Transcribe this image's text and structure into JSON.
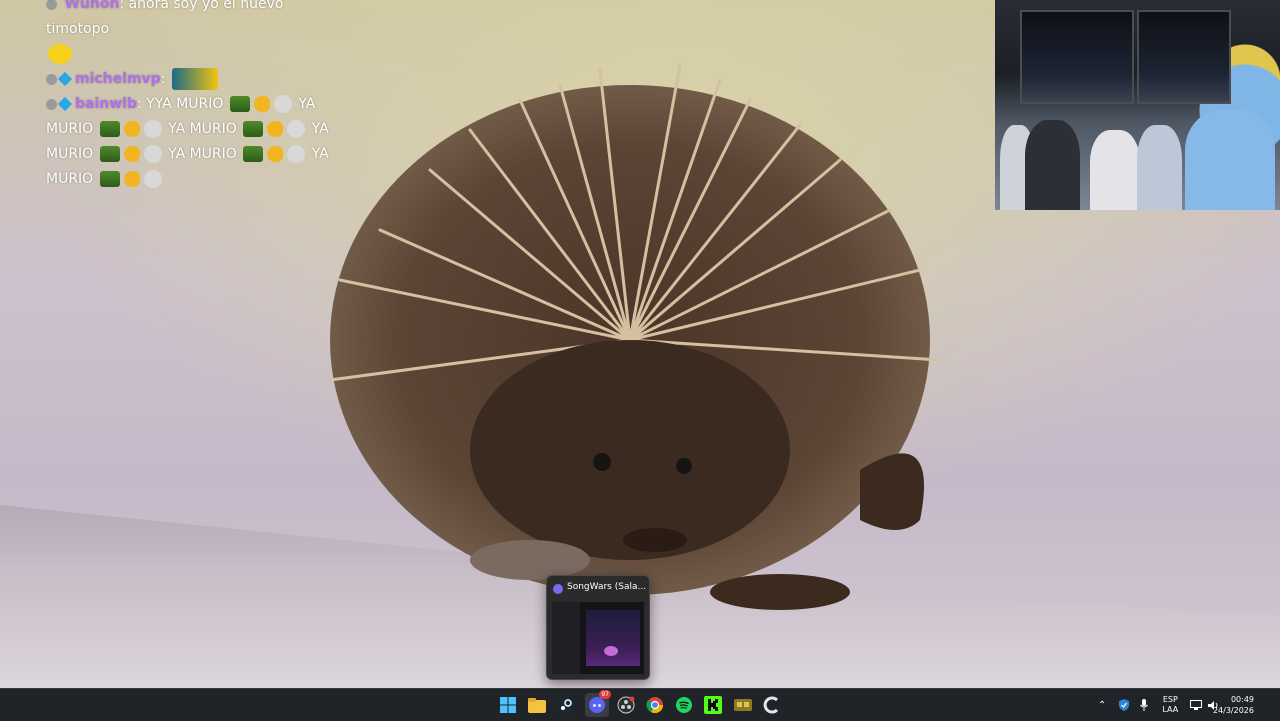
{
  "chat": {
    "messages": [
      {
        "user": "Wuhoh",
        "text": ": ahora soy yo el nuevo timotopo"
      },
      {
        "user": "",
        "text": ""
      },
      {
        "user": "michelmvp",
        "text": ":"
      },
      {
        "user": "bainwlb",
        "text": ": YYA MURIO"
      }
    ],
    "spam_words": [
      "YA",
      "MURIO",
      "YA MURIO",
      "YA",
      "MURIO",
      "YA MURIO",
      "YA",
      "MURIO"
    ]
  },
  "preview": {
    "title": "SongWars (Sala..."
  },
  "taskbar": {
    "icons": [
      "windows-start-icon",
      "file-explorer-icon",
      "steam-icon",
      "discord-icon",
      "obs-icon",
      "chrome-icon",
      "spotify-icon",
      "kick-icon",
      "game-icon",
      "ccleaner-icon"
    ],
    "badge": "97"
  },
  "tray": {
    "lang_top": "ESP",
    "lang_bottom": "LAA",
    "time": "00:49",
    "date": "24/3/2026"
  }
}
